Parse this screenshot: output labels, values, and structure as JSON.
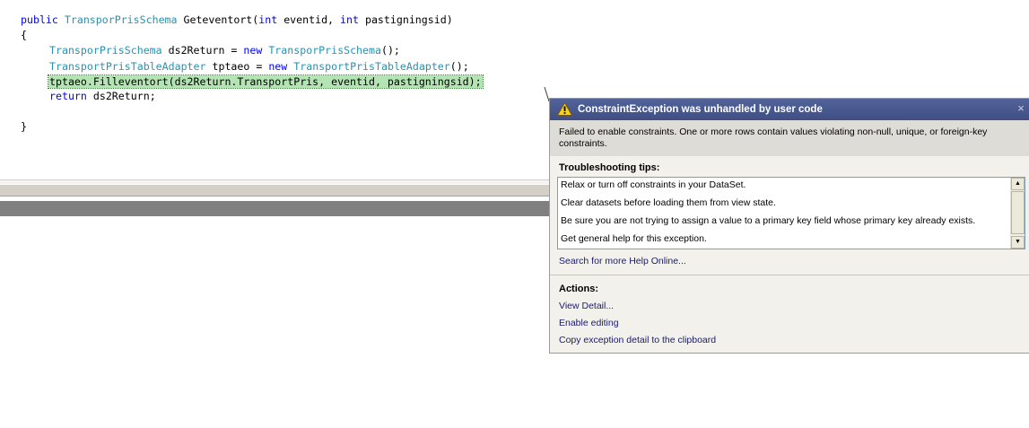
{
  "editor": {
    "lines": [
      {
        "t1": "public",
        "t2": " ",
        "t3": "TransporPrisSchema",
        "t4": " Geteventort(",
        "t5": "int",
        "t6": " eventid, ",
        "t7": "int",
        "t8": " pastigningsid)"
      },
      {
        "text": "{"
      },
      {
        "t1": "TransporPrisSchema",
        "t2": " ds2Return = ",
        "t3": "new",
        "t4": " ",
        "t5": "TransporPrisSchema",
        "t6": "();"
      },
      {
        "t1": "TransportPrisTableAdapter",
        "t2": " tptaeo = ",
        "t3": "new",
        "t4": " ",
        "t5": "TransportPrisTableAdapter",
        "t6": "();"
      },
      {
        "text": "tptaeo.Filleventort(ds2Return.TransportPris, eventid, pastigningsid);"
      },
      {
        "t1": "return",
        "t2": " ds2Return;"
      },
      {
        "text": "}"
      }
    ]
  },
  "exception": {
    "title": "ConstraintException was unhandled by user code",
    "close_label": "×",
    "message": "Failed to enable constraints. One or more rows contain values violating non-null, unique, or foreign-key constraints.",
    "tips_heading": "Troubleshooting tips:",
    "tips": [
      "Relax or turn off constraints in your DataSet.",
      "Clear datasets before loading them from view state.",
      "Be sure you are not trying to assign a value to a primary key field whose primary key already exists.",
      "Get general help for this exception."
    ],
    "search_link": "Search for more Help Online...",
    "actions_heading": "Actions:",
    "actions": [
      "View Detail...",
      "Enable editing",
      "Copy exception detail to the clipboard"
    ]
  },
  "icons": {
    "warning": "warning-icon",
    "close": "close-icon",
    "scroll_up": "scroll-up-arrow-icon",
    "scroll_down": "scroll-down-arrow-icon"
  },
  "colors": {
    "keyword": "#0000ff",
    "type": "#2b91af",
    "highlight": "#b4e4b4",
    "title_bar": "#4a5a90"
  }
}
